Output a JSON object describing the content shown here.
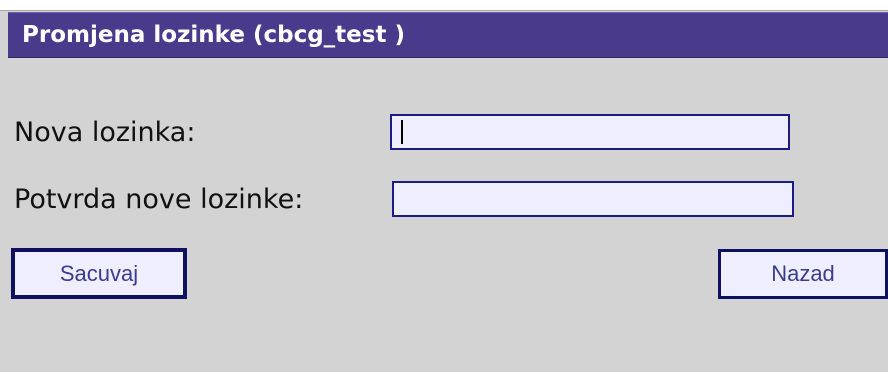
{
  "header": {
    "title": "Promjena lozinke (cbcg_test )"
  },
  "form": {
    "new_password_label": "Nova lozinka:",
    "confirm_password_label": "Potvrda nove lozinke:",
    "new_password_value": "",
    "confirm_password_value": ""
  },
  "buttons": {
    "save_label": "Sacuvaj",
    "back_label": "Nazad"
  },
  "colors": {
    "titlebar": "#4a3a8c",
    "background": "#d3d3d3",
    "input_fill": "#eeeeff",
    "input_border": "#1b1b80"
  }
}
